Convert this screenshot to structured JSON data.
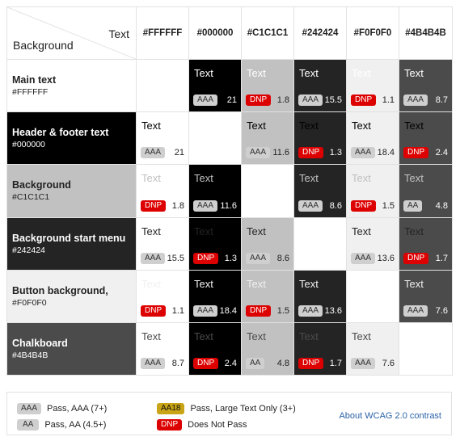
{
  "header": {
    "corner_text": "Text",
    "corner_background": "Background",
    "columns": [
      {
        "hex": "#FFFFFF",
        "bg": "#ffffff",
        "fg": "#222222"
      },
      {
        "hex": "#000000",
        "bg": "#000000",
        "fg": "#ffffff"
      },
      {
        "hex": "#C1C1C1",
        "bg": "#c1c1c1",
        "fg": "#222222"
      },
      {
        "hex": "#242424",
        "bg": "#242424",
        "fg": "#ffffff"
      },
      {
        "hex": "#F0F0F0",
        "bg": "#f0f0f0",
        "fg": "#222222"
      },
      {
        "hex": "#4B4B4B",
        "bg": "#4b4b4b",
        "fg": "#ffffff"
      }
    ]
  },
  "sample_text": "Text",
  "rows": [
    {
      "name": "Main text",
      "hex": "#FFFFFF",
      "bg": "#ffffff",
      "fg": "#222222",
      "cells": [
        null,
        {
          "badge": "AAA",
          "ratio": "21"
        },
        {
          "badge": "DNP",
          "ratio": "1.8"
        },
        {
          "badge": "AAA",
          "ratio": "15.5"
        },
        {
          "badge": "DNP",
          "ratio": "1.1"
        },
        {
          "badge": "AAA",
          "ratio": "8.7"
        }
      ]
    },
    {
      "name": "Header & footer text",
      "hex": "#000000",
      "bg": "#000000",
      "fg": "#ffffff",
      "cells": [
        {
          "badge": "AAA",
          "ratio": "21"
        },
        null,
        {
          "badge": "AAA",
          "ratio": "11.6"
        },
        {
          "badge": "DNP",
          "ratio": "1.3"
        },
        {
          "badge": "AAA",
          "ratio": "18.4"
        },
        {
          "badge": "DNP",
          "ratio": "2.4"
        }
      ]
    },
    {
      "name": "Background",
      "hex": "#C1C1C1",
      "bg": "#c1c1c1",
      "fg": "#222222",
      "cells": [
        {
          "badge": "DNP",
          "ratio": "1.8"
        },
        {
          "badge": "AAA",
          "ratio": "11.6"
        },
        null,
        {
          "badge": "AAA",
          "ratio": "8.6"
        },
        {
          "badge": "DNP",
          "ratio": "1.5"
        },
        {
          "badge": "AA",
          "ratio": "4.8"
        }
      ]
    },
    {
      "name": "Background start menu",
      "hex": "#242424",
      "bg": "#242424",
      "fg": "#ffffff",
      "cells": [
        {
          "badge": "AAA",
          "ratio": "15.5"
        },
        {
          "badge": "DNP",
          "ratio": "1.3"
        },
        {
          "badge": "AAA",
          "ratio": "8.6"
        },
        null,
        {
          "badge": "AAA",
          "ratio": "13.6"
        },
        {
          "badge": "DNP",
          "ratio": "1.7"
        }
      ]
    },
    {
      "name": "Button background,",
      "hex": "#F0F0F0",
      "bg": "#f0f0f0",
      "fg": "#222222",
      "cells": [
        {
          "badge": "DNP",
          "ratio": "1.1"
        },
        {
          "badge": "AAA",
          "ratio": "18.4"
        },
        {
          "badge": "DNP",
          "ratio": "1.5"
        },
        {
          "badge": "AAA",
          "ratio": "13.6"
        },
        null,
        {
          "badge": "AAA",
          "ratio": "7.6"
        }
      ]
    },
    {
      "name": "Chalkboard",
      "hex": "#4B4B4B",
      "bg": "#4b4b4b",
      "fg": "#ffffff",
      "cells": [
        {
          "badge": "AAA",
          "ratio": "8.7"
        },
        {
          "badge": "DNP",
          "ratio": "2.4"
        },
        {
          "badge": "AA",
          "ratio": "4.8"
        },
        {
          "badge": "DNP",
          "ratio": "1.7"
        },
        {
          "badge": "AAA",
          "ratio": "7.6"
        },
        null
      ]
    }
  ],
  "legend": {
    "aaa_badge": "AAA",
    "aaa_label": "Pass, AAA (7+)",
    "aa_badge": "AA",
    "aa_label": "Pass, AA (4.5+)",
    "aa18_badge": "AA18",
    "aa18_label": "Pass, Large Text Only (3+)",
    "dnp_badge": "DNP",
    "dnp_label": "Does Not Pass",
    "about_link": "About WCAG 2.0 contrast"
  },
  "colors": {
    "dnp": "#dd0000",
    "aa18": "#c8a416",
    "aaa": "#cfcfcf",
    "link": "#2a63a8"
  }
}
